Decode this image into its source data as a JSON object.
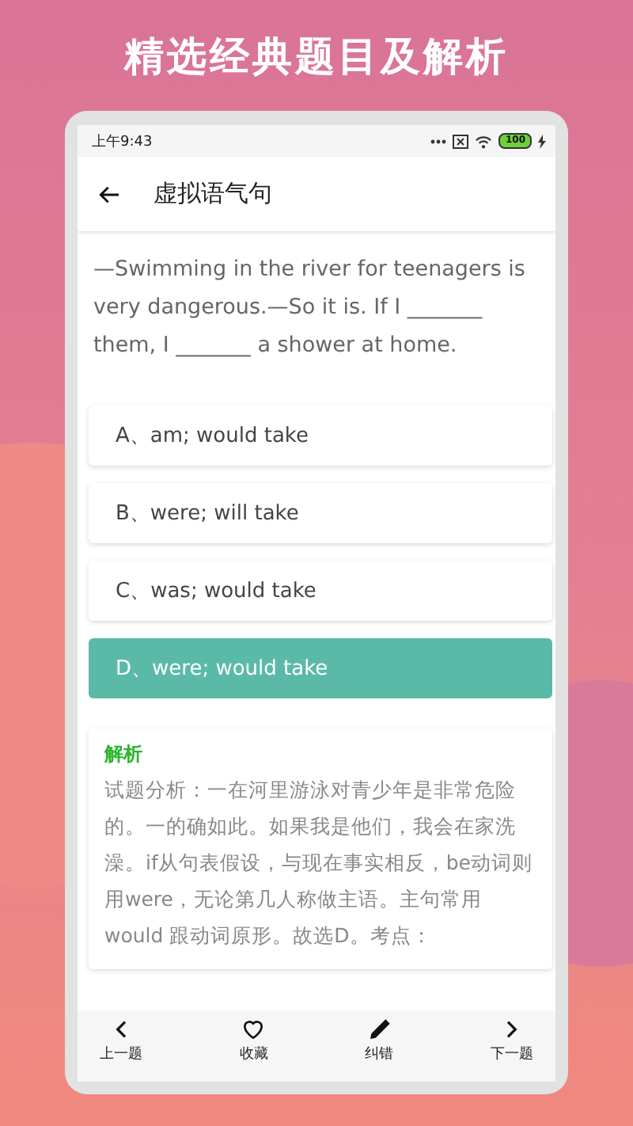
{
  "headline": "精选经典题目及解析",
  "status_bar": {
    "time": "上午9:43",
    "battery": "100",
    "charging": true
  },
  "app_bar": {
    "title": "虚拟语气句"
  },
  "question": "—Swimming in the river for teenagers is very dangerous.—So it is. If I _______ them, I _______ a shower at home.",
  "options": [
    {
      "label": "A、am; would take",
      "selected": false
    },
    {
      "label": "B、were; will take",
      "selected": false
    },
    {
      "label": "C、was; would take",
      "selected": false
    },
    {
      "label": "D、were; would take",
      "selected": true
    }
  ],
  "analysis": {
    "title": "解析",
    "text": "试题分析：一在河里游泳对青少年是非常危险的。一的确如此。如果我是他们，我会在家洗澡。if从句表假设，与现在事实相反，be动词则用were，无论第几人称做主语。主句常用would 跟动词原形。故选D。考点："
  },
  "bottom_nav": [
    {
      "kind": "prev",
      "label": "上一题"
    },
    {
      "kind": "favorite",
      "label": "收藏"
    },
    {
      "kind": "edit",
      "label": "纠错"
    },
    {
      "kind": "next",
      "label": "下一题"
    }
  ]
}
